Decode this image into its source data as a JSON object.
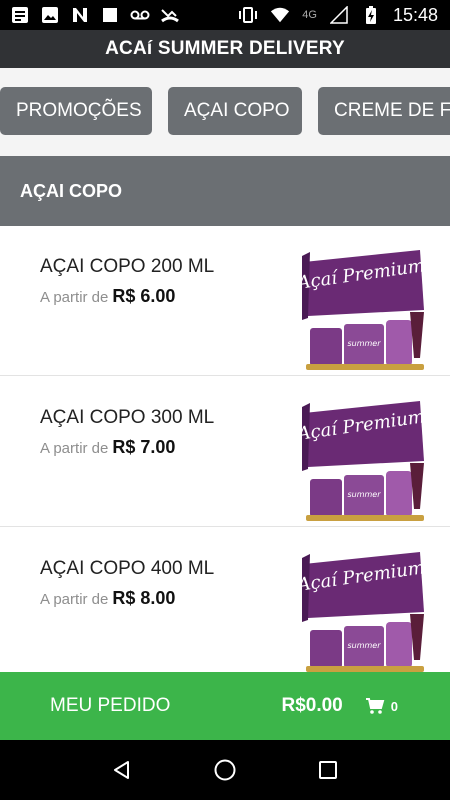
{
  "status_bar": {
    "network": "4G",
    "time": "15:48"
  },
  "app_bar": {
    "title": "ACAí SUMMER DELIVERY"
  },
  "tabs": [
    {
      "label": "PROMOÇÕES"
    },
    {
      "label": "AÇAI COPO"
    },
    {
      "label": "CREME DE FR"
    }
  ],
  "section": {
    "title": "AÇAI COPO"
  },
  "products": [
    {
      "name": "AÇAI COPO 200 ML",
      "from_label": "A partir de",
      "price": "R$ 6.00",
      "image_text": "Açaí Premium",
      "image_brand": "summer"
    },
    {
      "name": "AÇAI COPO 300 ML",
      "from_label": "A partir de",
      "price": "R$ 7.00",
      "image_text": "Açaí Premium",
      "image_brand": "summer"
    },
    {
      "name": "AÇAI COPO 400 ML",
      "from_label": "A partir de",
      "price": "R$ 8.00",
      "image_text": "Açaí Premium",
      "image_brand": "summer"
    }
  ],
  "order_bar": {
    "label": "MEU PEDIDO",
    "total": "R$0.00",
    "cart_count": "0",
    "icon": "cart-icon"
  },
  "colors": {
    "app_bar": "#303235",
    "tab": "#6b6f73",
    "order_bar": "#3cb54a",
    "brand_purple": "#6a2a74"
  }
}
